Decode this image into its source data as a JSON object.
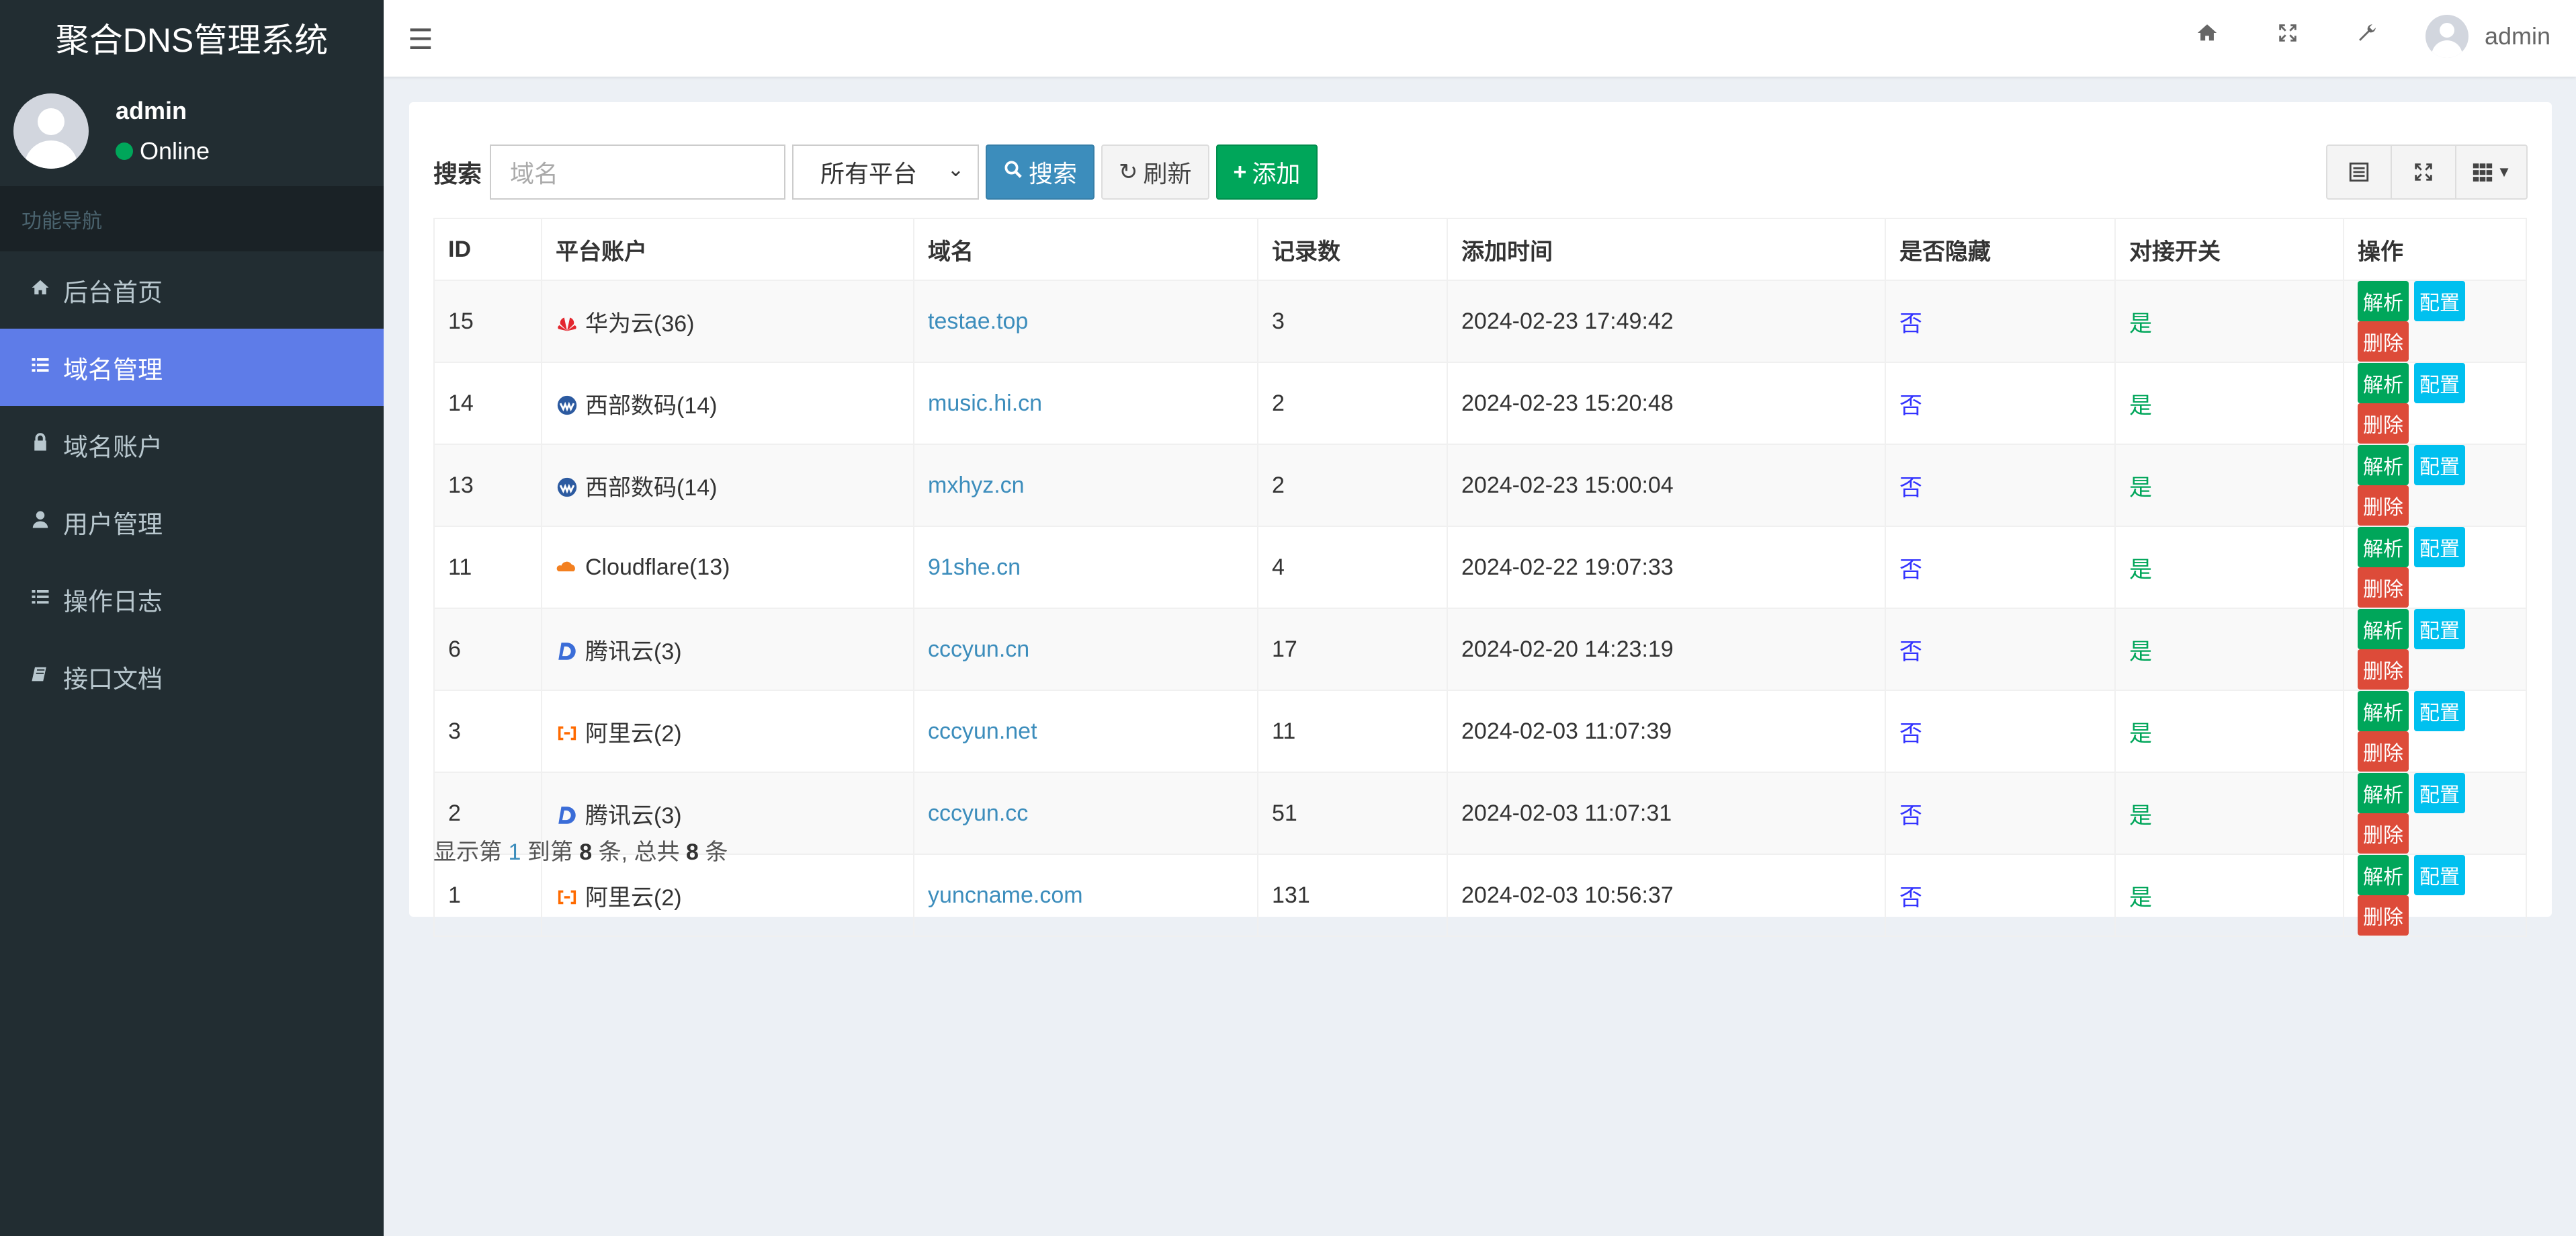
{
  "sidebar": {
    "title": "聚合DNS管理系统",
    "user": {
      "name": "admin",
      "status": "Online"
    },
    "nav_header": "功能导航",
    "items": [
      {
        "label": "后台首页",
        "icon": "home-icon"
      },
      {
        "label": "域名管理",
        "icon": "list-icon",
        "active": true
      },
      {
        "label": "域名账户",
        "icon": "lock-icon"
      },
      {
        "label": "用户管理",
        "icon": "user-icon"
      },
      {
        "label": "操作日志",
        "icon": "list-icon"
      },
      {
        "label": "接口文档",
        "icon": "book-icon"
      }
    ]
  },
  "header": {
    "username": "admin",
    "icons": [
      "hamburger-icon",
      "home-icon",
      "fullscreen-icon",
      "wrench-icon"
    ]
  },
  "toolbar": {
    "search_label": "搜索",
    "search_placeholder": "域名",
    "platform_select": "所有平台",
    "search_button": "搜索",
    "refresh_button": "刷新",
    "add_button": "添加"
  },
  "table": {
    "headers": [
      "ID",
      "平台账户",
      "域名",
      "记录数",
      "添加时间",
      "是否隐藏",
      "对接开关",
      "操作"
    ],
    "rows": [
      {
        "id": "15",
        "account": "华为云(36)",
        "platform": "huawei",
        "domain": "testae.top",
        "records": "3",
        "time": "2024-02-23 17:49:42",
        "hidden": "否",
        "switch": "是"
      },
      {
        "id": "14",
        "account": "西部数码(14)",
        "platform": "west",
        "domain": "music.hi.cn",
        "records": "2",
        "time": "2024-02-23 15:20:48",
        "hidden": "否",
        "switch": "是"
      },
      {
        "id": "13",
        "account": "西部数码(14)",
        "platform": "west",
        "domain": "mxhyz.cn",
        "records": "2",
        "time": "2024-02-23 15:00:04",
        "hidden": "否",
        "switch": "是"
      },
      {
        "id": "11",
        "account": "Cloudflare(13)",
        "platform": "cloudflare",
        "domain": "91she.cn",
        "records": "4",
        "time": "2024-02-22 19:07:33",
        "hidden": "否",
        "switch": "是"
      },
      {
        "id": "6",
        "account": "腾讯云(3)",
        "platform": "dnspod",
        "domain": "cccyun.cn",
        "records": "17",
        "time": "2024-02-20 14:23:19",
        "hidden": "否",
        "switch": "是"
      },
      {
        "id": "3",
        "account": "阿里云(2)",
        "platform": "aliyun",
        "domain": "cccyun.net",
        "records": "11",
        "time": "2024-02-03 11:07:39",
        "hidden": "否",
        "switch": "是"
      },
      {
        "id": "2",
        "account": "腾讯云(3)",
        "platform": "dnspod",
        "domain": "cccyun.cc",
        "records": "51",
        "time": "2024-02-03 11:07:31",
        "hidden": "否",
        "switch": "是"
      },
      {
        "id": "1",
        "account": "阿里云(2)",
        "platform": "aliyun",
        "domain": "yuncname.com",
        "records": "131",
        "time": "2024-02-03 10:56:37",
        "hidden": "否",
        "switch": "是"
      }
    ],
    "actions": [
      "解析",
      "配置",
      "删除"
    ]
  },
  "summary": {
    "p1": "显示第 ",
    "start": "1",
    "p2": " 到第 ",
    "end": "8",
    "p3": " 条, 总共 ",
    "total": "8",
    "p4": " 条"
  },
  "colors": {
    "accent": "#5e7ce8",
    "sidebar_bg": "#222d32",
    "primary": "#3c8dbc",
    "success": "#00a65a",
    "danger": "#dd4b39",
    "info": "#00c0ef"
  }
}
